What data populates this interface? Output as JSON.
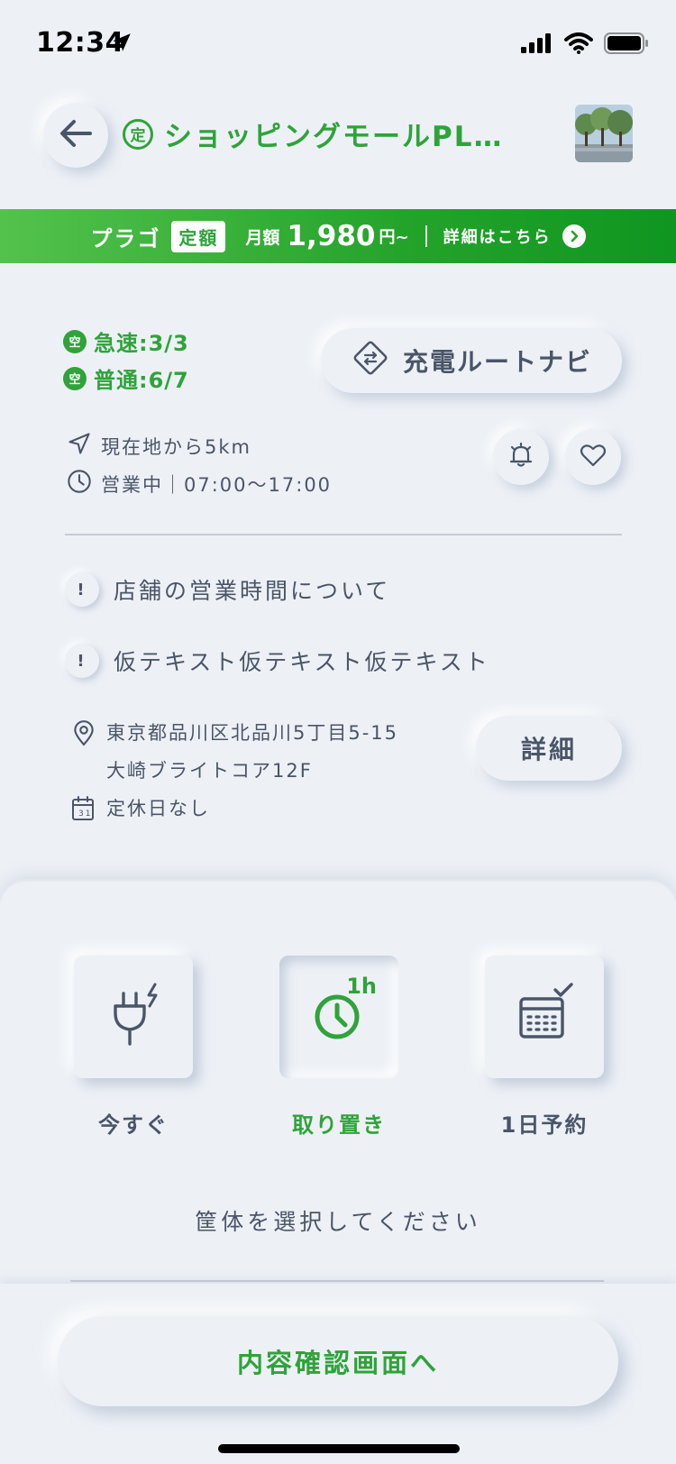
{
  "status_bar": {
    "time": "12:34"
  },
  "header": {
    "badge": "定",
    "title": "ショッピングモールPL…"
  },
  "banner": {
    "plan": "プラゴ",
    "plan_type": "定額",
    "monthly_label": "月額",
    "price": "1,980",
    "price_suffix": "円~",
    "detail_link": "詳細はこちら"
  },
  "availability": {
    "badge": "空",
    "fast": "急速:3/3",
    "normal": "普通:6/7"
  },
  "route_nav_label": "充電ルートナビ",
  "location": {
    "distance": "現在地から5km",
    "hours": "営業中｜07:00～17:00"
  },
  "notices": [
    {
      "mark": "!",
      "text": "店舗の営業時間について"
    },
    {
      "mark": "!",
      "text": "仮テキスト仮テキスト仮テキスト"
    }
  ],
  "address": {
    "line1": "東京都品川区北品川5丁目5-15",
    "line2": "大崎ブライトコア12F",
    "holiday": "定休日なし",
    "calendar_num": "31"
  },
  "detail_button": "詳細",
  "options": [
    {
      "label": "今すぐ",
      "icon": "plug-icon"
    },
    {
      "label": "取り置き",
      "icon": "clock-icon",
      "badge": "1h"
    },
    {
      "label": "1日予約",
      "icon": "calendar-icon"
    }
  ],
  "select_hint": "筐体を選択してください",
  "confirm_button": "内容確認画面へ",
  "colors": {
    "accent": "#2fa33a",
    "background": "#edf1f6",
    "text": "#4a5568"
  }
}
